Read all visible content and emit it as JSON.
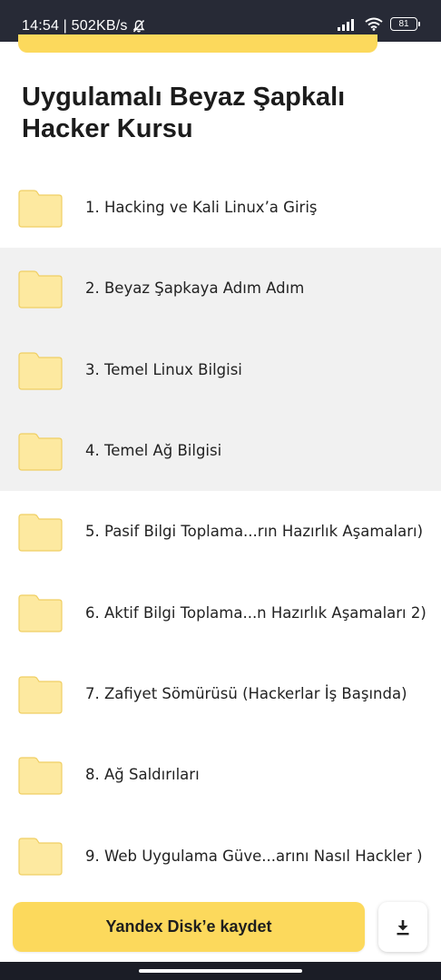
{
  "status_bar": {
    "time_speed": "14:54 | 502KB/s",
    "battery": "81"
  },
  "title": "Uygulamalı Beyaz Şapkalı Hacker Kursu",
  "folders": [
    {
      "label": "1. Hacking ve Kali Linux’a Giriş"
    },
    {
      "label": "2. Beyaz Şapkaya Adım Adım"
    },
    {
      "label": "3. Temel Linux Bilgisi"
    },
    {
      "label": "4. Temel Ağ Bilgisi"
    },
    {
      "label": "5. Pasif Bilgi Toplama...rın Hazırlık Aşamaları)"
    },
    {
      "label": "6. Aktif Bilgi Toplama...n Hazırlık Aşamaları 2)"
    },
    {
      "label": "7. Zafiyet Sömürüsü (Hackerlar İş Başında)"
    },
    {
      "label": "8. Ağ Saldırıları"
    },
    {
      "label": "9. Web Uygulama Güve...arını Nasıl Hackler )"
    }
  ],
  "actions": {
    "save_label": "Yandex Disk’e kaydet",
    "download_icon": "download-icon"
  },
  "colors": {
    "accent": "#fcd95c",
    "folder_fill": "#fde9a0",
    "status_bar": "#272a36",
    "highlight_row": "#f1f1f1"
  }
}
